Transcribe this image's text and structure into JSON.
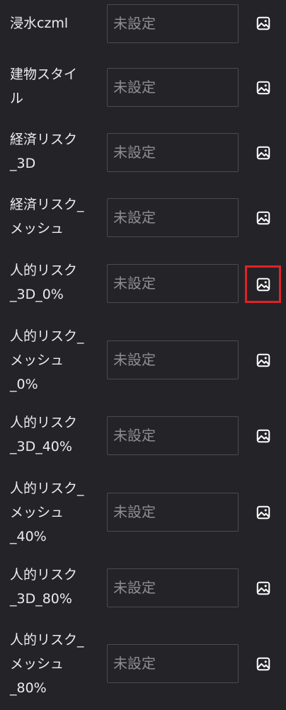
{
  "panel": {
    "rows": [
      {
        "label": "浸水czml",
        "value": "未設定",
        "icon": "image-icon"
      },
      {
        "label": "建物スタイ\nル",
        "value": "未設定",
        "icon": "image-icon"
      },
      {
        "label": "経済リスク\n_3D",
        "value": "未設定",
        "icon": "image-icon"
      },
      {
        "label": "経済リスク_\nメッシュ",
        "value": "未設定",
        "icon": "image-icon"
      },
      {
        "label": "人的リスク\n_3D_0%",
        "value": "未設定",
        "icon": "image-icon"
      },
      {
        "label": "人的リスク_\nメッシュ\n_0%",
        "value": "未設定",
        "icon": "image-icon"
      },
      {
        "label": "人的リスク\n_3D_40%",
        "value": "未設定",
        "icon": "image-icon"
      },
      {
        "label": "人的リスク_\nメッシュ\n_40%",
        "value": "未設定",
        "icon": "image-icon"
      },
      {
        "label": "人的リスク\n_3D_80%",
        "value": "未設定",
        "icon": "image-icon"
      },
      {
        "label": "人的リスク_\nメッシュ\n_80%",
        "value": "未設定",
        "icon": "image-icon"
      }
    ]
  },
  "highlight": {
    "row_index": 4,
    "color": "#e32126"
  }
}
